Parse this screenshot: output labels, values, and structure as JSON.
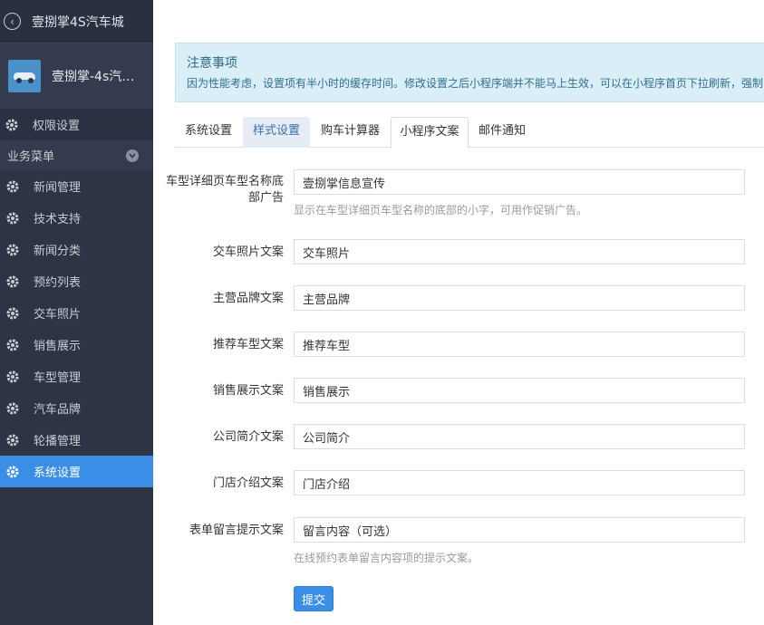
{
  "sidebar": {
    "title": "壹捌掌4S汽车城",
    "shop_name": "壹捌掌-4s汽车...",
    "permission_label": "权限设置",
    "section_label": "业务菜单",
    "items": [
      {
        "label": "新闻管理"
      },
      {
        "label": "技术支持"
      },
      {
        "label": "新闻分类"
      },
      {
        "label": "预约列表"
      },
      {
        "label": "交车照片"
      },
      {
        "label": "销售展示"
      },
      {
        "label": "车型管理"
      },
      {
        "label": "汽车品牌"
      },
      {
        "label": "轮播管理"
      },
      {
        "label": "系统设置"
      }
    ]
  },
  "notice": {
    "title": "注意事项",
    "text": "因为性能考虑，设置项有半小时的缓存时间。修改设置之后小程序端并不能马上生效，可以在小程序首页下拉刷新，强制"
  },
  "tabs": [
    {
      "label": "系统设置"
    },
    {
      "label": "样式设置"
    },
    {
      "label": "购车计算器"
    },
    {
      "label": "小程序文案"
    },
    {
      "label": "邮件通知"
    }
  ],
  "form": {
    "ad_label": "车型详细页车型名称底部广告",
    "ad_value": "壹捌掌信息宣传",
    "ad_help": "显示在车型详细页车型名称的底部的小字，可用作促销广告。",
    "delivery_label": "交车照片文案",
    "delivery_value": "交车照片",
    "brand_label": "主营品牌文案",
    "brand_value": "主营品牌",
    "recommend_label": "推荐车型文案",
    "recommend_value": "推荐车型",
    "sales_label": "销售展示文案",
    "sales_value": "销售展示",
    "company_label": "公司简介文案",
    "company_value": "公司简介",
    "store_label": "门店介绍文案",
    "store_value": "门店介绍",
    "message_label": "表单留言提示文案",
    "message_value": "留言内容（可选）",
    "message_help": "在线预约表单留言内容项的提示文案。",
    "submit_label": "提交"
  },
  "colors": {
    "sidebar_bg": "#2e3445",
    "accent": "#3a8ee6",
    "notice_bg": "#d9eef6"
  },
  "icons": {
    "back": "back-circle-icon",
    "menu": "gear-icon",
    "section": "chevron-down-icon"
  }
}
